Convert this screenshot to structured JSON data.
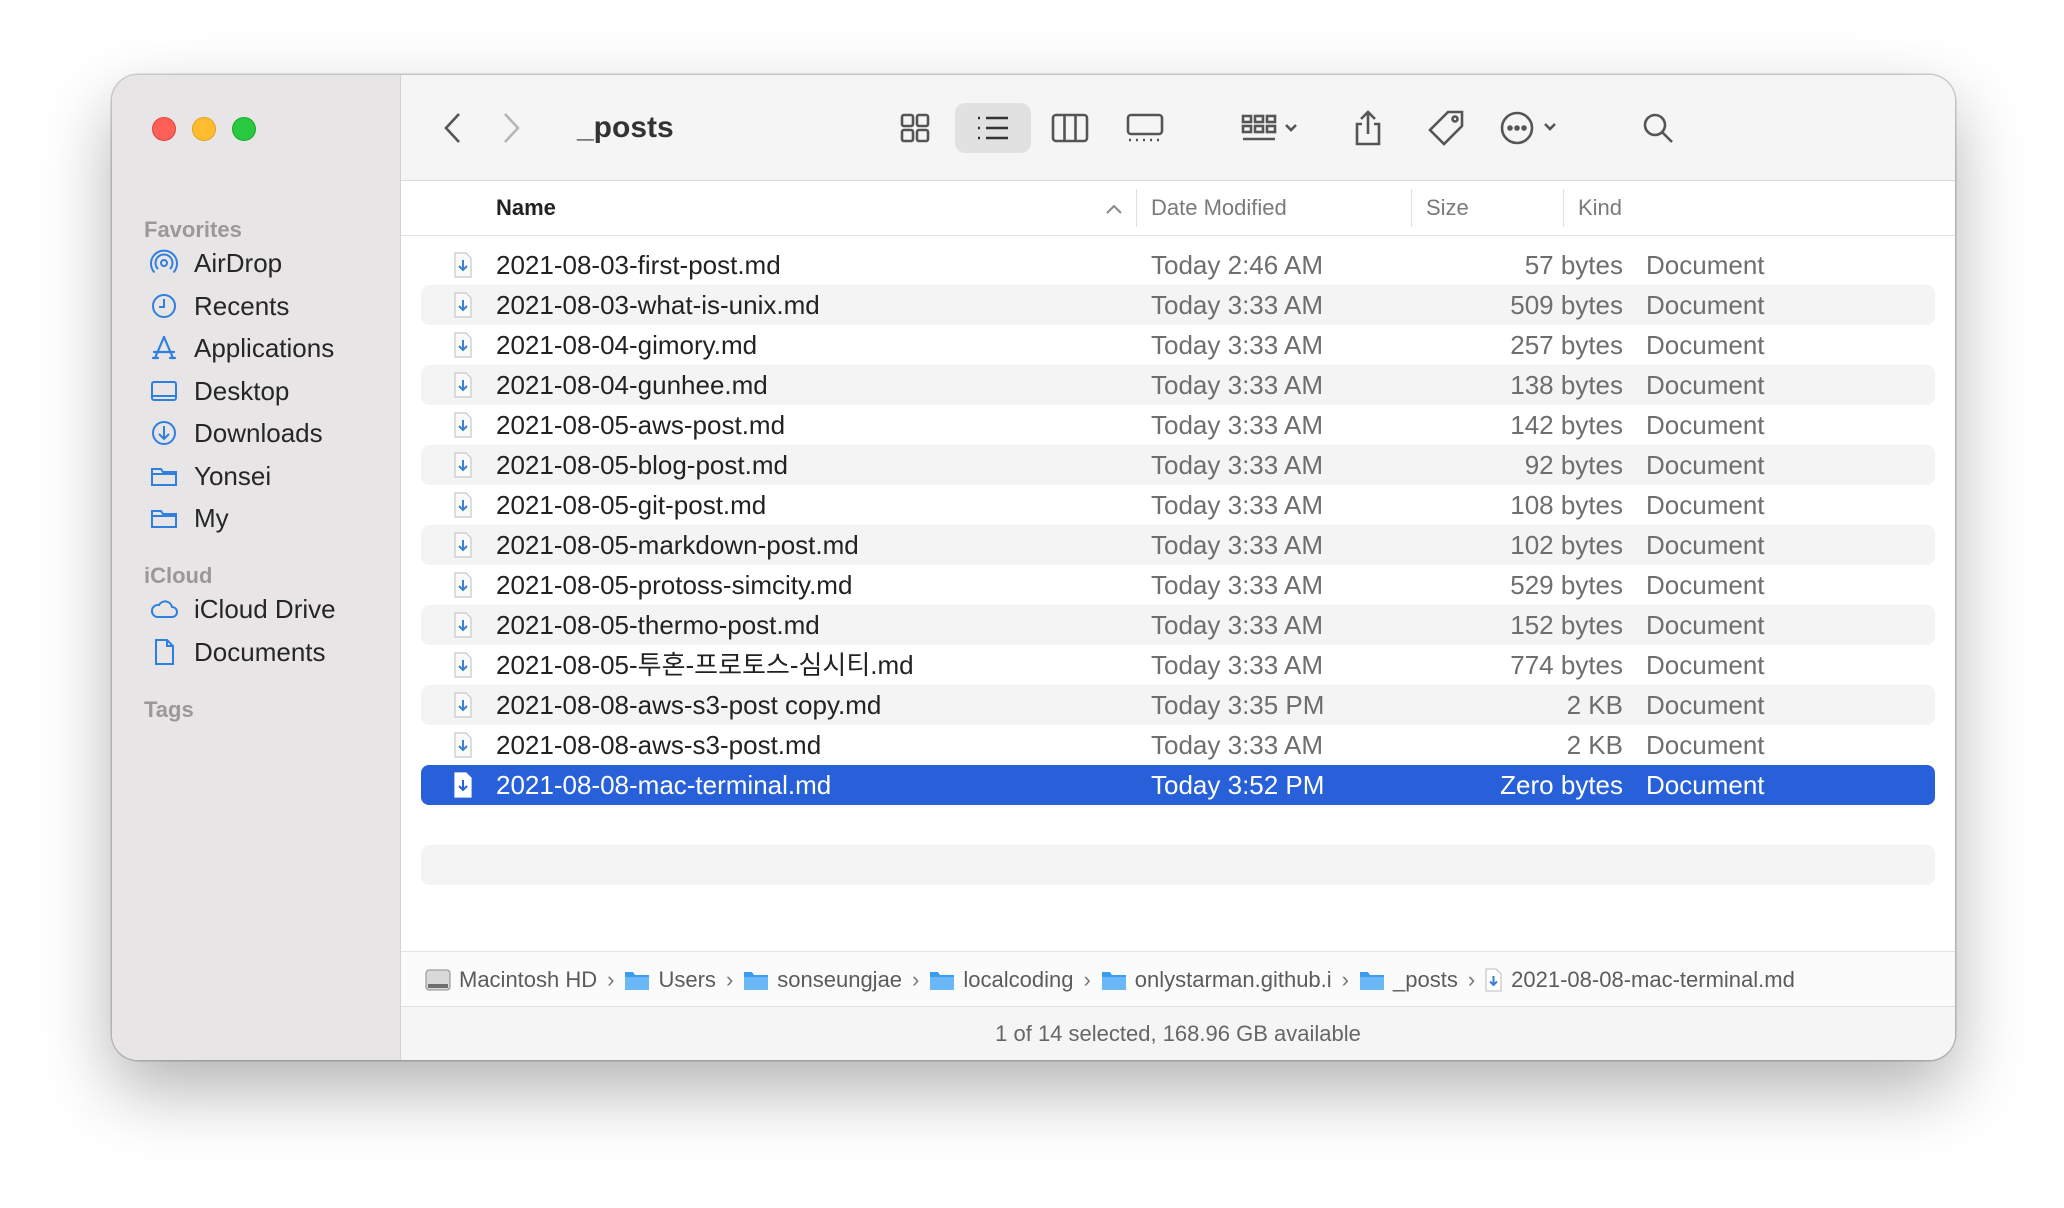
{
  "window": {
    "title": "_posts"
  },
  "sidebar": {
    "favorites_heading": "Favorites",
    "favorites": [
      {
        "label": "AirDrop",
        "icon": "airdrop-icon"
      },
      {
        "label": "Recents",
        "icon": "clock-icon"
      },
      {
        "label": "Applications",
        "icon": "applications-icon"
      },
      {
        "label": "Desktop",
        "icon": "desktop-icon"
      },
      {
        "label": "Downloads",
        "icon": "downloads-icon"
      },
      {
        "label": "Yonsei",
        "icon": "folder-icon"
      },
      {
        "label": "My",
        "icon": "folder-icon"
      }
    ],
    "icloud_heading": "iCloud",
    "icloud": [
      {
        "label": "iCloud Drive",
        "icon": "cloud-icon"
      },
      {
        "label": "Documents",
        "icon": "document-icon"
      }
    ],
    "tags_heading": "Tags"
  },
  "columns": {
    "name": "Name",
    "date": "Date Modified",
    "size": "Size",
    "kind": "Kind"
  },
  "files": [
    {
      "name": "2021-08-03-first-post.md",
      "date": "Today 2:46 AM",
      "size": "57 bytes",
      "kind": "Document"
    },
    {
      "name": "2021-08-03-what-is-unix.md",
      "date": "Today 3:33 AM",
      "size": "509 bytes",
      "kind": "Document"
    },
    {
      "name": "2021-08-04-gimory.md",
      "date": "Today 3:33 AM",
      "size": "257 bytes",
      "kind": "Document"
    },
    {
      "name": "2021-08-04-gunhee.md",
      "date": "Today 3:33 AM",
      "size": "138 bytes",
      "kind": "Document"
    },
    {
      "name": "2021-08-05-aws-post.md",
      "date": "Today 3:33 AM",
      "size": "142 bytes",
      "kind": "Document"
    },
    {
      "name": "2021-08-05-blog-post.md",
      "date": "Today 3:33 AM",
      "size": "92 bytes",
      "kind": "Document"
    },
    {
      "name": "2021-08-05-git-post.md",
      "date": "Today 3:33 AM",
      "size": "108 bytes",
      "kind": "Document"
    },
    {
      "name": "2021-08-05-markdown-post.md",
      "date": "Today 3:33 AM",
      "size": "102 bytes",
      "kind": "Document"
    },
    {
      "name": "2021-08-05-protoss-simcity.md",
      "date": "Today 3:33 AM",
      "size": "529 bytes",
      "kind": "Document"
    },
    {
      "name": "2021-08-05-thermo-post.md",
      "date": "Today 3:33 AM",
      "size": "152 bytes",
      "kind": "Document"
    },
    {
      "name": "2021-08-05-투혼-프로토스-심시티.md",
      "date": "Today 3:33 AM",
      "size": "774 bytes",
      "kind": "Document"
    },
    {
      "name": "2021-08-08-aws-s3-post copy.md",
      "date": "Today 3:35 PM",
      "size": "2 KB",
      "kind": "Document"
    },
    {
      "name": "2021-08-08-aws-s3-post.md",
      "date": "Today 3:33 AM",
      "size": "2 KB",
      "kind": "Document"
    },
    {
      "name": "2021-08-08-mac-terminal.md",
      "date": "Today 3:52 PM",
      "size": "Zero bytes",
      "kind": "Document",
      "selected": true
    }
  ],
  "path": [
    "Macintosh HD",
    "Users",
    "sonseungjae",
    "localcoding",
    "onlystarman.github.i",
    "_posts",
    "2021-08-08-mac-terminal.md"
  ],
  "status": "1 of 14 selected, 168.96 GB available",
  "colors": {
    "selection": "#2760d9",
    "folder": "#3b9cf0",
    "close": "#fe5f57",
    "minimize": "#febc2e",
    "maximize": "#28c840"
  }
}
